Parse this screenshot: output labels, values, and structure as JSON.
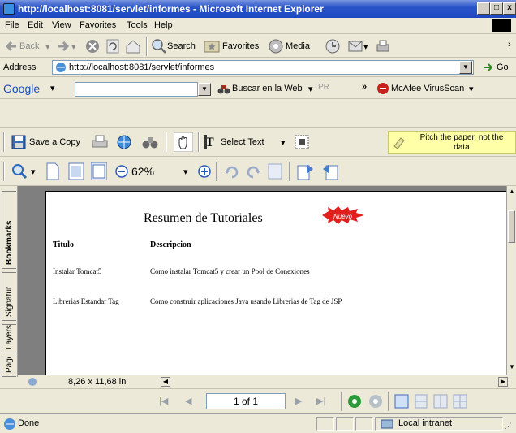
{
  "window": {
    "title": "http://localhost:8081/servlet/informes - Microsoft Internet Explorer",
    "controls": [
      "_",
      "□",
      "x"
    ]
  },
  "menu": [
    "File",
    "Edit",
    "View",
    "Favorites",
    "Tools",
    "Help"
  ],
  "nav_toolbar": {
    "back": "Back",
    "search": "Search",
    "favorites": "Favorites",
    "media": "Media"
  },
  "address": {
    "label": "Address",
    "url": "http://localhost:8081/servlet/informes",
    "go": "Go"
  },
  "google_bar": {
    "logo": "Google",
    "search_value": "",
    "buscar": "Buscar en la Web",
    "extra": "»",
    "mcafee": "McAfee VirusScan"
  },
  "pdf_toolbar": {
    "save_copy": "Save a Copy",
    "select_text": "Select Text",
    "note": "Pitch the paper, not the data",
    "zoom": "62%"
  },
  "side_tabs": [
    "Bookmarks",
    "Signatur",
    "Layers",
    "Pages"
  ],
  "document": {
    "title": "Resumen de Tutoriales",
    "badge": "Nuevo",
    "headers": {
      "titulo": "Titulo",
      "descripcion": "Descripcion"
    },
    "rows": [
      {
        "titulo": "Instalar Tomcat5",
        "descripcion": "Como instalar Tomcat5 y crear un Pool de Conexiones"
      },
      {
        "titulo": "Librerias Estandar Tag",
        "descripcion": "Como construir aplicaciones Java usando Librerias de Tag de JSP"
      }
    ]
  },
  "page_size": "8,26 x 11,68 in",
  "page_nav": {
    "current": "1 of 1"
  },
  "status": {
    "text": "Done",
    "zone": "Local intranet"
  },
  "colors": {
    "titlebar": "#1c47c2",
    "note_bg": "#ffffa8",
    "doc_bg": "#7f7f7f",
    "badge": "#e0201c"
  }
}
